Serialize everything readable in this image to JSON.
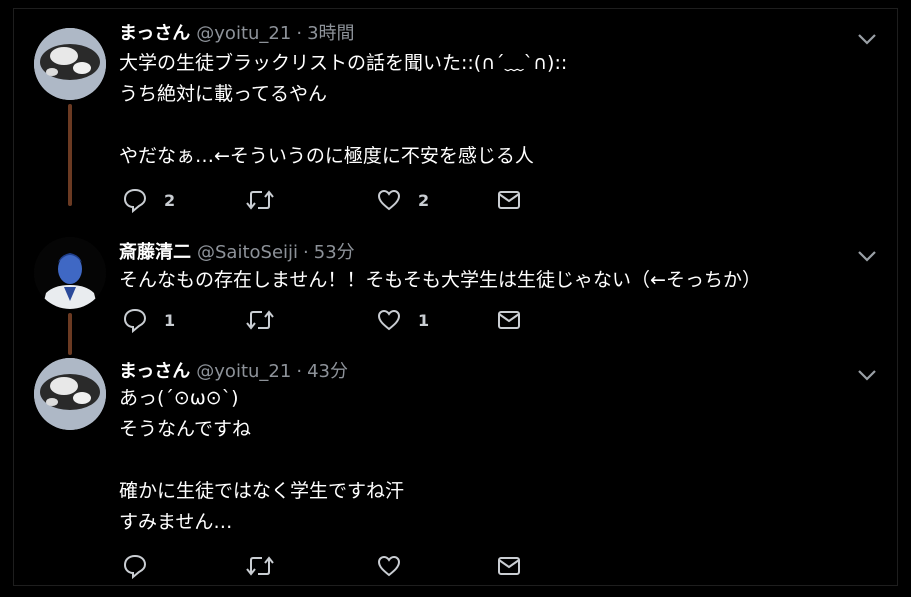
{
  "tweets": [
    {
      "name": "まっさん",
      "handle": "@yoitu_21",
      "separator": "·",
      "time": "3時間",
      "text": "大学の生徒ブラックリストの話を聞いた::(∩´﹏`∩)::\nうち絶対に載ってるやん\n\nやだなぁ…←そういうのに極度に不安を感じる人",
      "reply_count": "2",
      "like_count": "2"
    },
    {
      "name": "斎藤清二",
      "handle": "@SaitoSeiji",
      "separator": "·",
      "time": "53分",
      "text": "そんなもの存在しません！！そもそも大学生は生徒じゃない（←そっちか）",
      "reply_count": "1",
      "like_count": "1"
    },
    {
      "name": "まっさん",
      "handle": "@yoitu_21",
      "separator": "·",
      "time": "43分",
      "text": "あっ(´⊙ω⊙`)\nそうなんですね\n\n確かに生徒ではなく学生ですね汗\nすみません…",
      "reply_count": "",
      "like_count": ""
    }
  ],
  "colors": {
    "background": "#000000",
    "secondary_text": "#8d9299",
    "icon": "#c9cdd2",
    "thread_line": "#6b3a22"
  },
  "icons": [
    "reply-icon",
    "retweet-icon",
    "like-icon",
    "share-mail-icon",
    "chevron-down-icon"
  ]
}
